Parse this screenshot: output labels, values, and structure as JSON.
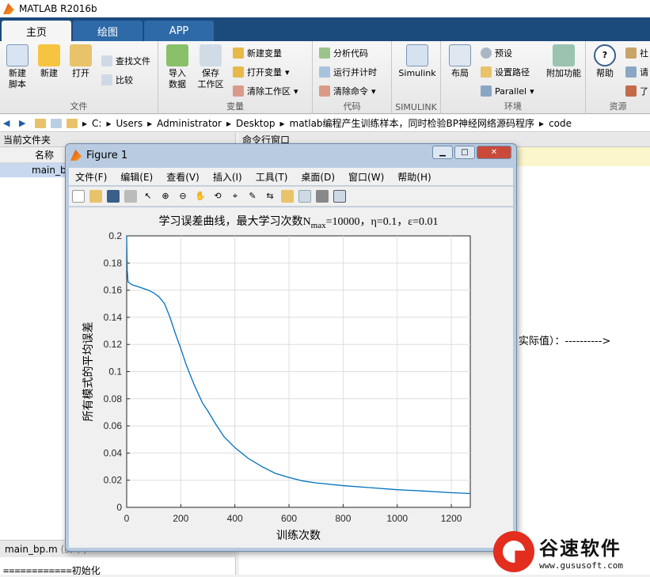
{
  "window": {
    "title": "MATLAB R2016b"
  },
  "tabs": [
    {
      "label": "主页"
    },
    {
      "label": "绘图"
    },
    {
      "label": "APP"
    }
  ],
  "ribbon": {
    "file": {
      "label": "文件",
      "new_script": "新建\n脚本",
      "new": "新建",
      "open": "打开",
      "find_files": "查找文件",
      "compare": "比较"
    },
    "variable": {
      "label": "变量",
      "import": "导入\n数据",
      "save_ws": "保存\n工作区",
      "new_var": "新建变量",
      "open_var": "打开变量",
      "clear_ws": "清除工作区"
    },
    "code": {
      "label": "代码",
      "analyze": "分析代码",
      "run_time": "运行并计时",
      "clear_cmd": "清除命令"
    },
    "simulink": {
      "label": "SIMULINK",
      "simulink": "Simulink"
    },
    "env": {
      "label": "环境",
      "layout": "布局",
      "prefs": "预设",
      "set_path": "设置路径",
      "parallel": "Parallel",
      "addons": "附加功能"
    },
    "resources": {
      "label": "资源",
      "help": "帮助",
      "c1": "社",
      "c2": "请",
      "c3": "了"
    }
  },
  "address": {
    "parts": [
      "C:",
      "Users",
      "Administrator",
      "Desktop",
      "matlab编程产生训练样本，同时检验BP神经网络源码程序",
      "code"
    ]
  },
  "left_panel": {
    "title": "当前文件夹",
    "col_name": "名称",
    "file": "main_b",
    "bottom_tab": "main_bp.m",
    "bottom_tab_suffix": "(脚本)",
    "bottom_text": "============初始化"
  },
  "right_panel": {
    "title": "命令行窗口",
    "cmd_text": "实际值）：---------->"
  },
  "figure": {
    "title": "Figure 1",
    "menu": [
      "文件(F)",
      "编辑(E)",
      "查看(V)",
      "插入(I)",
      "工具(T)",
      "桌面(D)",
      "窗口(W)",
      "帮助(H)"
    ]
  },
  "chart_data": {
    "type": "line",
    "title": "学习误差曲线，最大学习次数N",
    "title_sub": "max",
    "title_rest": "=10000，η=0.1，ε=0.01",
    "xlabel": "训练次数",
    "ylabel": "所有模式的平均误差",
    "xlim": [
      0,
      1270
    ],
    "ylim": [
      0,
      0.2
    ],
    "xticks": [
      0,
      200,
      400,
      600,
      800,
      1000,
      1200
    ],
    "yticks": [
      0,
      0.02,
      0.04,
      0.06,
      0.08,
      0.1,
      0.12,
      0.14,
      0.16,
      0.18,
      0.2
    ],
    "grid": true,
    "color": "#0072bd",
    "x": [
      0,
      2,
      5,
      20,
      50,
      80,
      100,
      120,
      140,
      160,
      180,
      200,
      220,
      250,
      280,
      300,
      330,
      360,
      400,
      450,
      500,
      550,
      600,
      650,
      700,
      800,
      900,
      1000,
      1100,
      1200,
      1270
    ],
    "y": [
      0.2,
      0.175,
      0.166,
      0.164,
      0.162,
      0.16,
      0.158,
      0.155,
      0.15,
      0.14,
      0.128,
      0.117,
      0.105,
      0.09,
      0.077,
      0.071,
      0.061,
      0.052,
      0.044,
      0.036,
      0.03,
      0.025,
      0.022,
      0.0195,
      0.018,
      0.016,
      0.0145,
      0.013,
      0.012,
      0.0108,
      0.0102
    ]
  },
  "logo": {
    "name": "谷速软件",
    "url": "www.gususoft.com"
  }
}
